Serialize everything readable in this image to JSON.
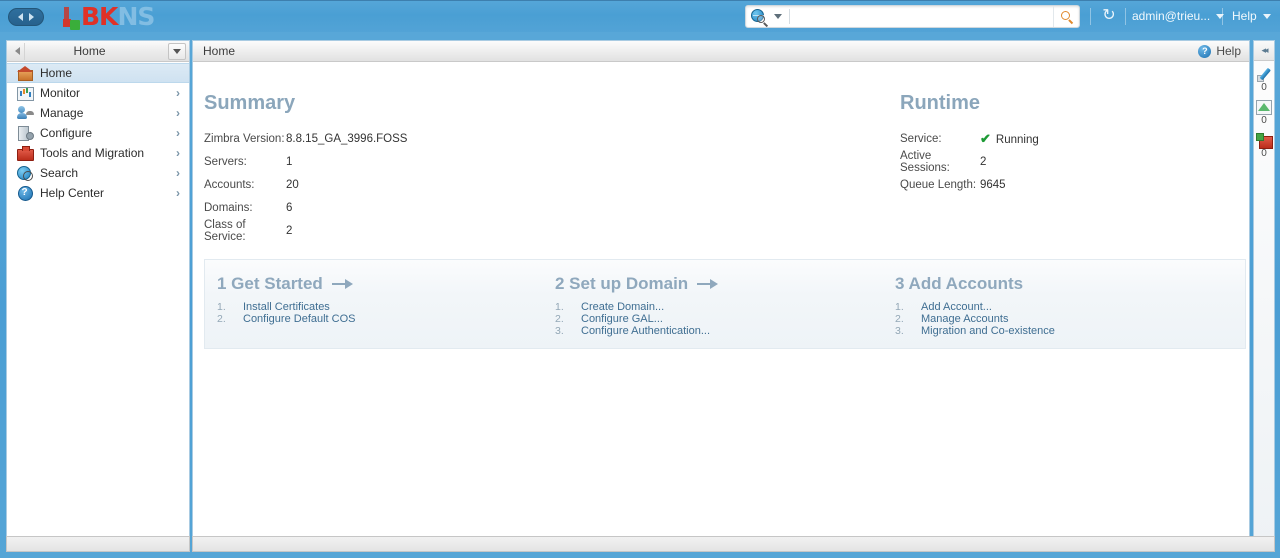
{
  "header": {
    "nav_back": "back-arrow",
    "nav_forward": "forward-arrow",
    "logo_primary": "BK",
    "logo_secondary": "NS",
    "search": {
      "value": "",
      "placeholder": "",
      "scope_icon": "globe-search-icon",
      "submit_icon": "magnifier-icon"
    },
    "refresh_glyph": "↻",
    "account": "admin@trieu...",
    "help": "Help"
  },
  "sidebar": {
    "selector_label": "Home",
    "items": [
      {
        "label": "Home",
        "icon": "home-icon",
        "active": true,
        "has_chevron": false
      },
      {
        "label": "Monitor",
        "icon": "monitor-icon",
        "active": false,
        "has_chevron": true
      },
      {
        "label": "Manage",
        "icon": "manage-icon",
        "active": false,
        "has_chevron": true
      },
      {
        "label": "Configure",
        "icon": "configure-icon",
        "active": false,
        "has_chevron": true
      },
      {
        "label": "Tools and Migration",
        "icon": "tools-icon",
        "active": false,
        "has_chevron": true
      },
      {
        "label": "Search",
        "icon": "search-icon",
        "active": false,
        "has_chevron": true
      },
      {
        "label": "Help Center",
        "icon": "help-icon",
        "active": false,
        "has_chevron": true
      }
    ],
    "chevron_glyph": "›"
  },
  "content_header": {
    "breadcrumb": "Home",
    "help_label": "Help",
    "help_icon_glyph": "?"
  },
  "summary": {
    "title": "Summary",
    "rows": [
      {
        "key": "Zimbra Version:",
        "value": "8.8.15_GA_3996.FOSS"
      },
      {
        "key": "Servers:",
        "value": "1"
      },
      {
        "key": "Accounts:",
        "value": "20"
      },
      {
        "key": "Domains:",
        "value": "6"
      },
      {
        "key": "Class of Service:",
        "value": "2"
      }
    ]
  },
  "runtime": {
    "title": "Runtime",
    "service_key": "Service:",
    "service_value": "Running",
    "service_check": "✔",
    "rows": [
      {
        "key": "Active Sessions:",
        "value": "2"
      },
      {
        "key": "Queue Length:",
        "value": "9645"
      }
    ]
  },
  "steps": [
    {
      "title": "1 Get Started",
      "links": [
        {
          "num": "1.",
          "label": "Install Certificates"
        },
        {
          "num": "2.",
          "label": "Configure Default COS"
        }
      ],
      "has_arrow": true
    },
    {
      "title": "2 Set up Domain",
      "links": [
        {
          "num": "1.",
          "label": "Create Domain..."
        },
        {
          "num": "2.",
          "label": "Configure GAL..."
        },
        {
          "num": "3.",
          "label": "Configure Authentication..."
        }
      ],
      "has_arrow": true
    },
    {
      "title": "3 Add Accounts",
      "links": [
        {
          "num": "1.",
          "label": "Add Account..."
        },
        {
          "num": "2.",
          "label": "Manage Accounts"
        },
        {
          "num": "3.",
          "label": "Migration and Co-existence"
        }
      ],
      "has_arrow": false
    }
  ],
  "rail": {
    "collapse_glyph": "◂◂",
    "items": [
      {
        "icon": "compose-pen-icon",
        "count": "0"
      },
      {
        "icon": "monitor-chart-icon",
        "count": "0"
      },
      {
        "icon": "tools-box-icon",
        "count": "0"
      }
    ]
  },
  "colors": {
    "header_blue": "#4a9fd4",
    "accent_title": "#8ba6bb",
    "link_blue": "#3f6e92",
    "status_green": "#1d9a35",
    "logo_red": "#e03127",
    "logo_blue": "#8cc3e6"
  }
}
